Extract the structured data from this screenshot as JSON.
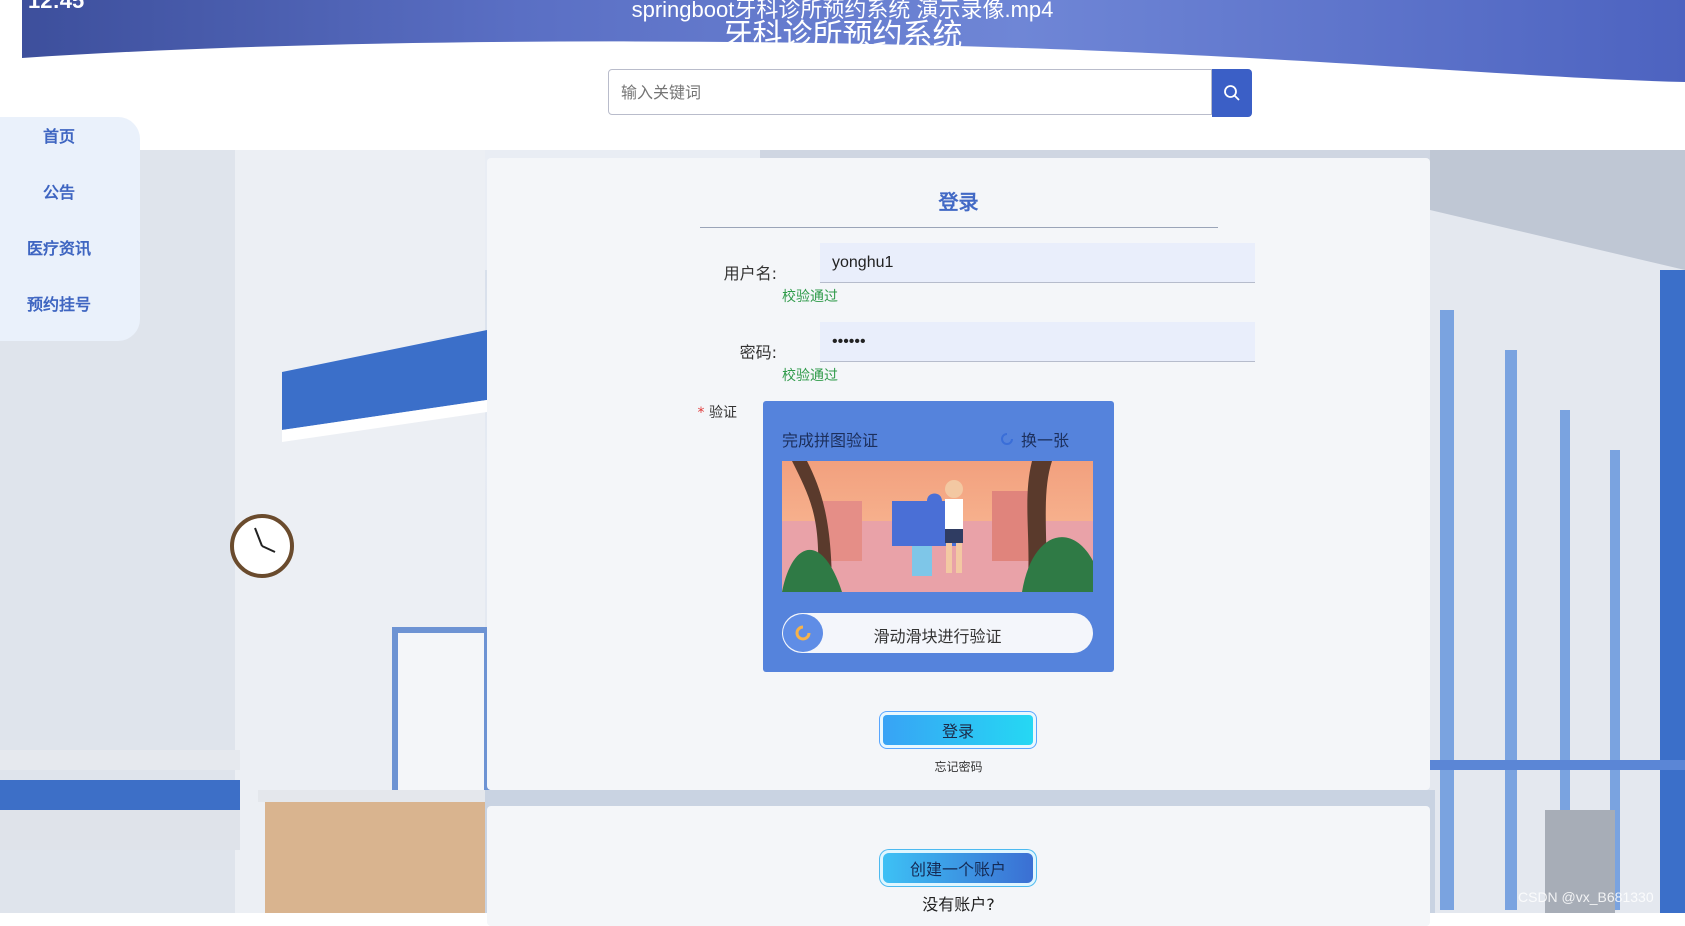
{
  "overlay": {
    "time": "12:45",
    "video_title": "springboot牙科诊所预约系统 演示录像.mp4",
    "watermark": "CSDN @vx_B681330"
  },
  "header": {
    "site_title": "牙科诊所预约系统",
    "search_placeholder": "输入关键词",
    "search_icon": "search-icon"
  },
  "sidebar": {
    "items": [
      {
        "label": "首页"
      },
      {
        "label": "公告"
      },
      {
        "label": "医疗资讯"
      },
      {
        "label": "预约挂号"
      }
    ]
  },
  "login": {
    "title": "登录",
    "username_label": "用户名:",
    "username_value": "yonghu1",
    "username_status": "校验通过",
    "password_label": "密码:",
    "password_value": "••••••",
    "password_status": "校验通过",
    "verify_required": "*",
    "verify_label": "验证",
    "captcha": {
      "title": "完成拼图验证",
      "refresh_label": "换一张",
      "slider_text": "滑动滑块进行验证"
    },
    "login_button": "登录",
    "forgot_password": "忘记密码"
  },
  "register": {
    "create_button": "创建一个账户",
    "no_account": "没有账户?"
  },
  "colors": {
    "accent": "#4269c5",
    "valid": "#2f9b4a",
    "captcha_bg": "#5583dc"
  }
}
